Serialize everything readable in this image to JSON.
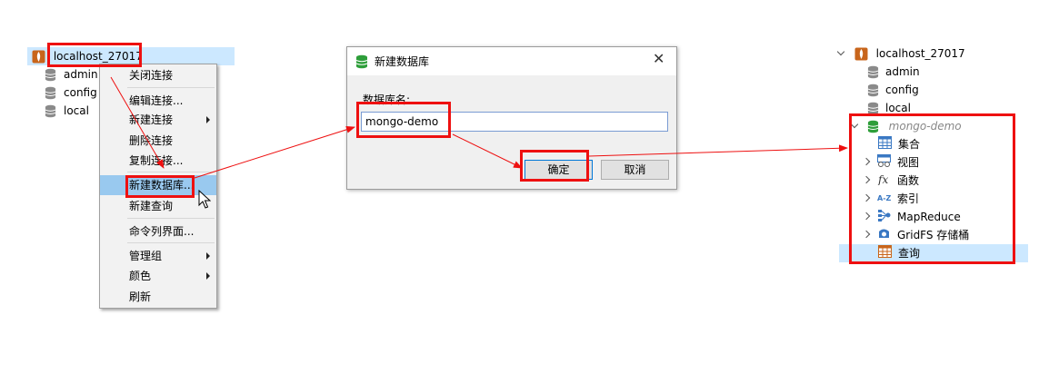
{
  "left_tree": {
    "connection": "localhost_27017",
    "dbs": [
      "admin",
      "config",
      "local"
    ]
  },
  "context_menu": {
    "items": [
      {
        "label": "关闭连接",
        "submenu": false
      },
      {
        "label": "编辑连接...",
        "submenu": false
      },
      {
        "label": "新建连接",
        "submenu": true
      },
      {
        "label": "删除连接",
        "submenu": false
      },
      {
        "label": "复制连接...",
        "submenu": false
      },
      {
        "label": "新建数据库...",
        "submenu": false,
        "highlighted": true
      },
      {
        "label": "新建查询",
        "submenu": false
      },
      {
        "label": "命令列界面...",
        "submenu": false
      },
      {
        "label": "管理组",
        "submenu": true
      },
      {
        "label": "颜色",
        "submenu": true
      },
      {
        "label": "刷新",
        "submenu": false
      }
    ]
  },
  "dialog": {
    "title": "新建数据库",
    "field_label": "数据库名:",
    "field_value": "mongo-demo",
    "ok_label": "确定",
    "cancel_label": "取消"
  },
  "right_tree": {
    "connection": "localhost_27017",
    "dbs": [
      "admin",
      "config",
      "local"
    ],
    "new_db": "mongo-demo",
    "children": [
      {
        "label": "集合",
        "icon": "table-icon",
        "expandable": false
      },
      {
        "label": "视图",
        "icon": "view-icon",
        "expandable": true
      },
      {
        "label": "函数",
        "icon": "function-icon",
        "expandable": true
      },
      {
        "label": "索引",
        "icon": "index-icon",
        "expandable": true
      },
      {
        "label": "MapReduce",
        "icon": "mapreduce-icon",
        "expandable": true
      },
      {
        "label": "GridFS 存储桶",
        "icon": "gridfs-icon",
        "expandable": true
      },
      {
        "label": "查询",
        "icon": "query-icon",
        "expandable": false
      }
    ]
  },
  "colors": {
    "annotation_red": "#ee1010",
    "selection": "#cce8ff",
    "db_green": "#2e9e3a"
  }
}
